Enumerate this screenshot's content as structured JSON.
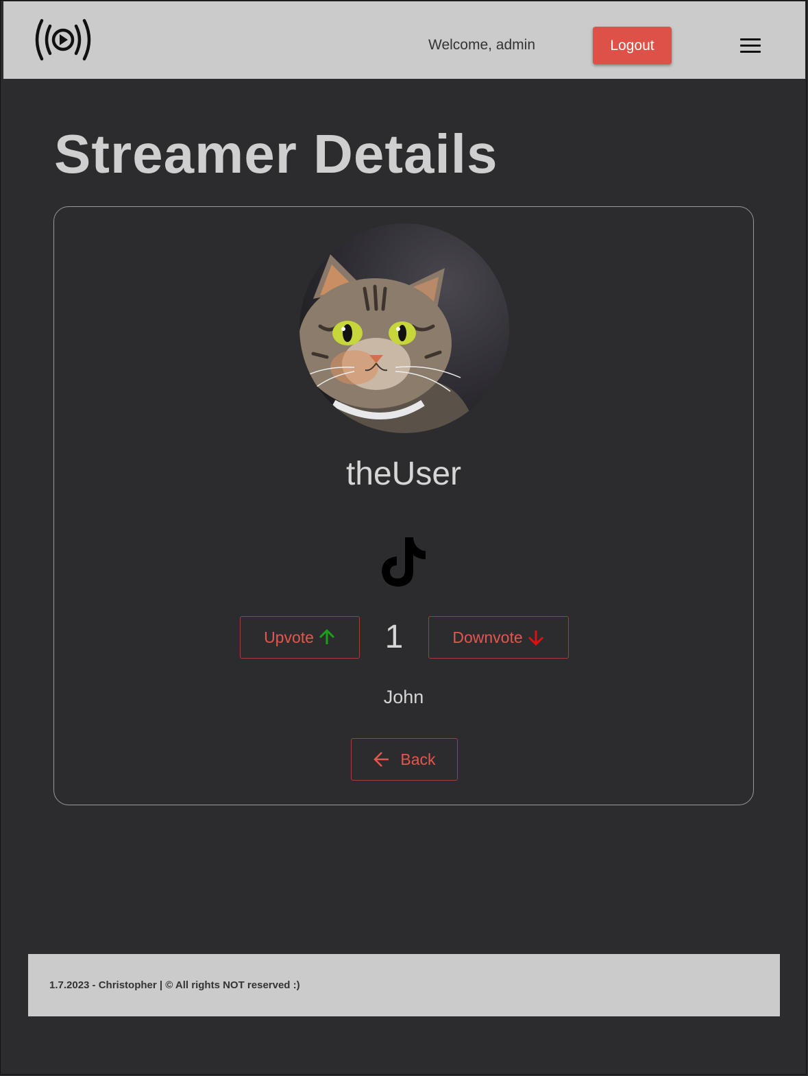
{
  "header": {
    "logo_icon": "live-stream-play-icon",
    "welcome_text": "Welcome, admin",
    "logout_label": "Logout",
    "menu_icon": "hamburger-menu-icon",
    "logout_color": "#dd5148"
  },
  "page": {
    "title": "Streamer Details"
  },
  "streamer": {
    "avatar_icon": "cat-avatar",
    "name": "theUser",
    "platform_icon": "tiktok-icon",
    "upvote_label": "Upvote",
    "downvote_label": "Downvote",
    "vote_count": "1",
    "owner": "John",
    "back_label": "Back"
  },
  "colors": {
    "background": "#2c2b2e",
    "accent": "#e4574d",
    "up_arrow": "#1aa01a",
    "down_arrow": "#e01010"
  },
  "footer": {
    "text": "1.7.2023 - Christopher | © All rights NOT reserved :)"
  }
}
